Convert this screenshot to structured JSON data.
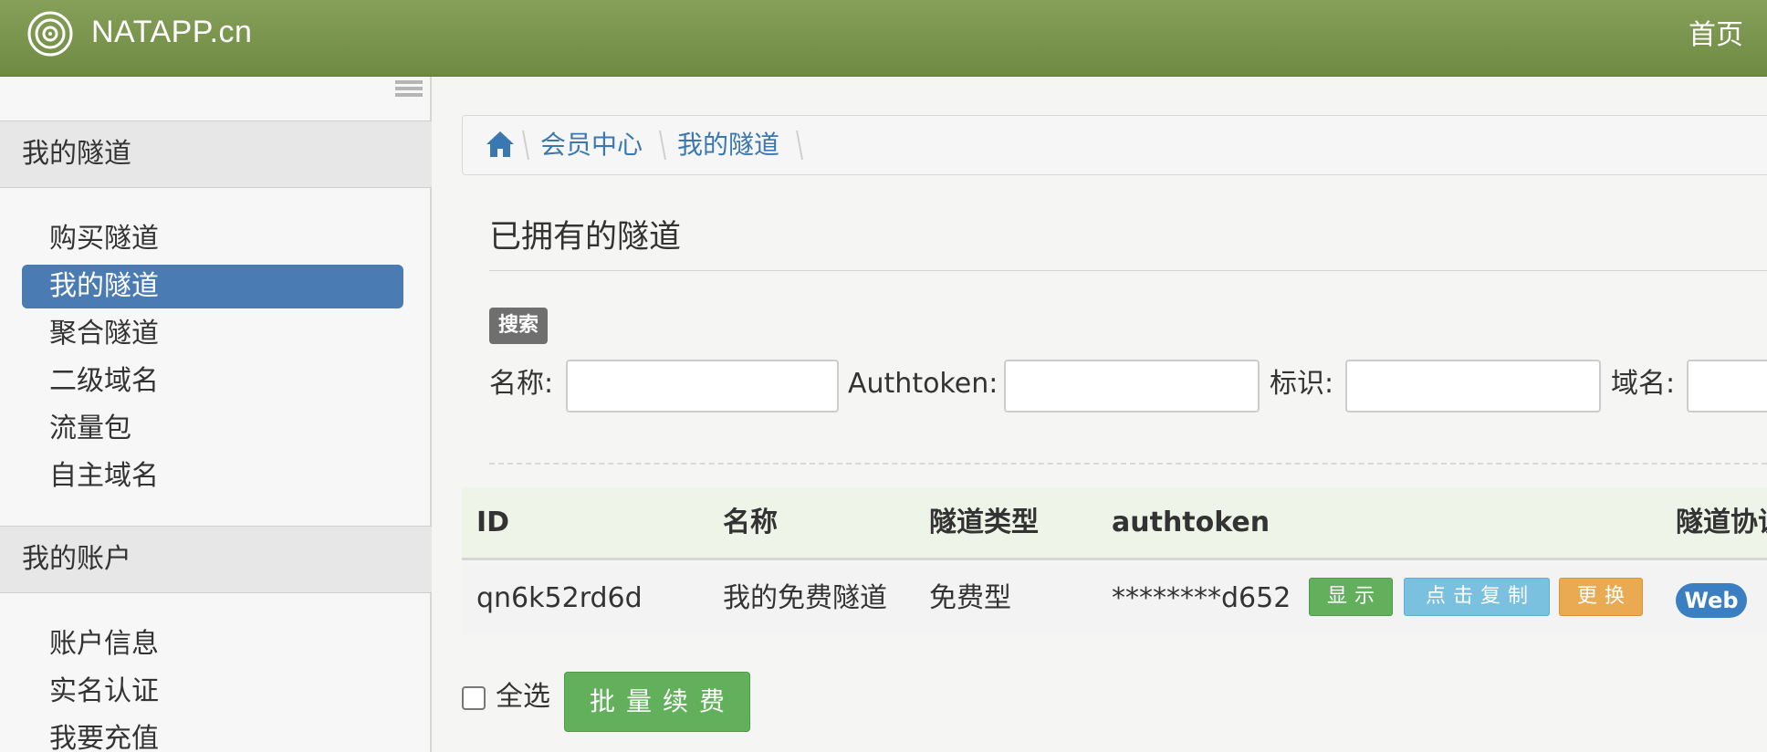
{
  "navbar": {
    "brand": "NATAPP.cn",
    "home_link": "首页"
  },
  "sidebar": {
    "groups": [
      {
        "title": "我的隧道",
        "items": [
          {
            "label": "购买隧道",
            "active": false
          },
          {
            "label": "我的隧道",
            "active": true
          },
          {
            "label": "聚合隧道",
            "active": false
          },
          {
            "label": "二级域名",
            "active": false
          },
          {
            "label": "流量包",
            "active": false
          },
          {
            "label": "自主域名",
            "active": false
          }
        ]
      },
      {
        "title": "我的账户",
        "items": [
          {
            "label": "账户信息",
            "active": false
          },
          {
            "label": "实名认证",
            "active": false
          },
          {
            "label": "我要充值",
            "active": false
          }
        ]
      }
    ]
  },
  "breadcrumb": [
    "会员中心",
    "我的隧道"
  ],
  "main": {
    "title": "已拥有的隧道",
    "search": {
      "badge": "搜索",
      "fields": [
        {
          "label": "名称:",
          "value": ""
        },
        {
          "label": "Authtoken:",
          "value": ""
        },
        {
          "label": "标识:",
          "value": ""
        },
        {
          "label": "域名:",
          "value": ""
        }
      ]
    },
    "table": {
      "columns": [
        "ID",
        "名称",
        "隧道类型",
        "authtoken",
        "隧道协议"
      ],
      "rows": [
        {
          "id": "qn6k52rd6d",
          "name": "我的免费隧道",
          "type": "免费型",
          "authtoken": "********d652",
          "actions": {
            "show": "显示",
            "copy": "点击复制",
            "change": "更换"
          },
          "protocol": "Web"
        }
      ]
    },
    "footer": {
      "select_all": "全选",
      "batch_renew": "批量续费"
    }
  },
  "colors": {
    "navbar": "#7a9a4c",
    "active_menu": "#4a7cb3",
    "link": "#3a78b4",
    "show_button": "#62b05b",
    "copy_button": "#7ac0df",
    "change_button": "#e9aa52",
    "protocol_badge": "#3a7fc1"
  }
}
